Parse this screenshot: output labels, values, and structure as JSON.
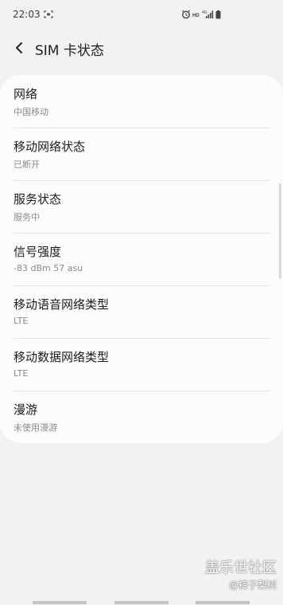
{
  "status_bar": {
    "time": "22:03",
    "hd_label": "HD",
    "network_label": "4G"
  },
  "header": {
    "title": "SIM 卡状态"
  },
  "items": [
    {
      "title": "网络",
      "value": "中国移动"
    },
    {
      "title": "移动网络状态",
      "value": "已断开"
    },
    {
      "title": "服务状态",
      "value": "服务中"
    },
    {
      "title": "信号强度",
      "value": "-83 dBm 57 asu"
    },
    {
      "title": "移动语音网络类型",
      "value": "LTE"
    },
    {
      "title": "移动数据网络类型",
      "value": "LTE"
    },
    {
      "title": "漫游",
      "value": "未使用漫游"
    }
  ],
  "watermark": {
    "line1": "盖乐世社区",
    "line2": "@裤子梨树"
  },
  "icons": {
    "back": "back-arrow-icon",
    "screenshot": "screenshot-icon",
    "alarm": "alarm-icon",
    "signal": "signal-icon",
    "battery": "battery-icon"
  }
}
